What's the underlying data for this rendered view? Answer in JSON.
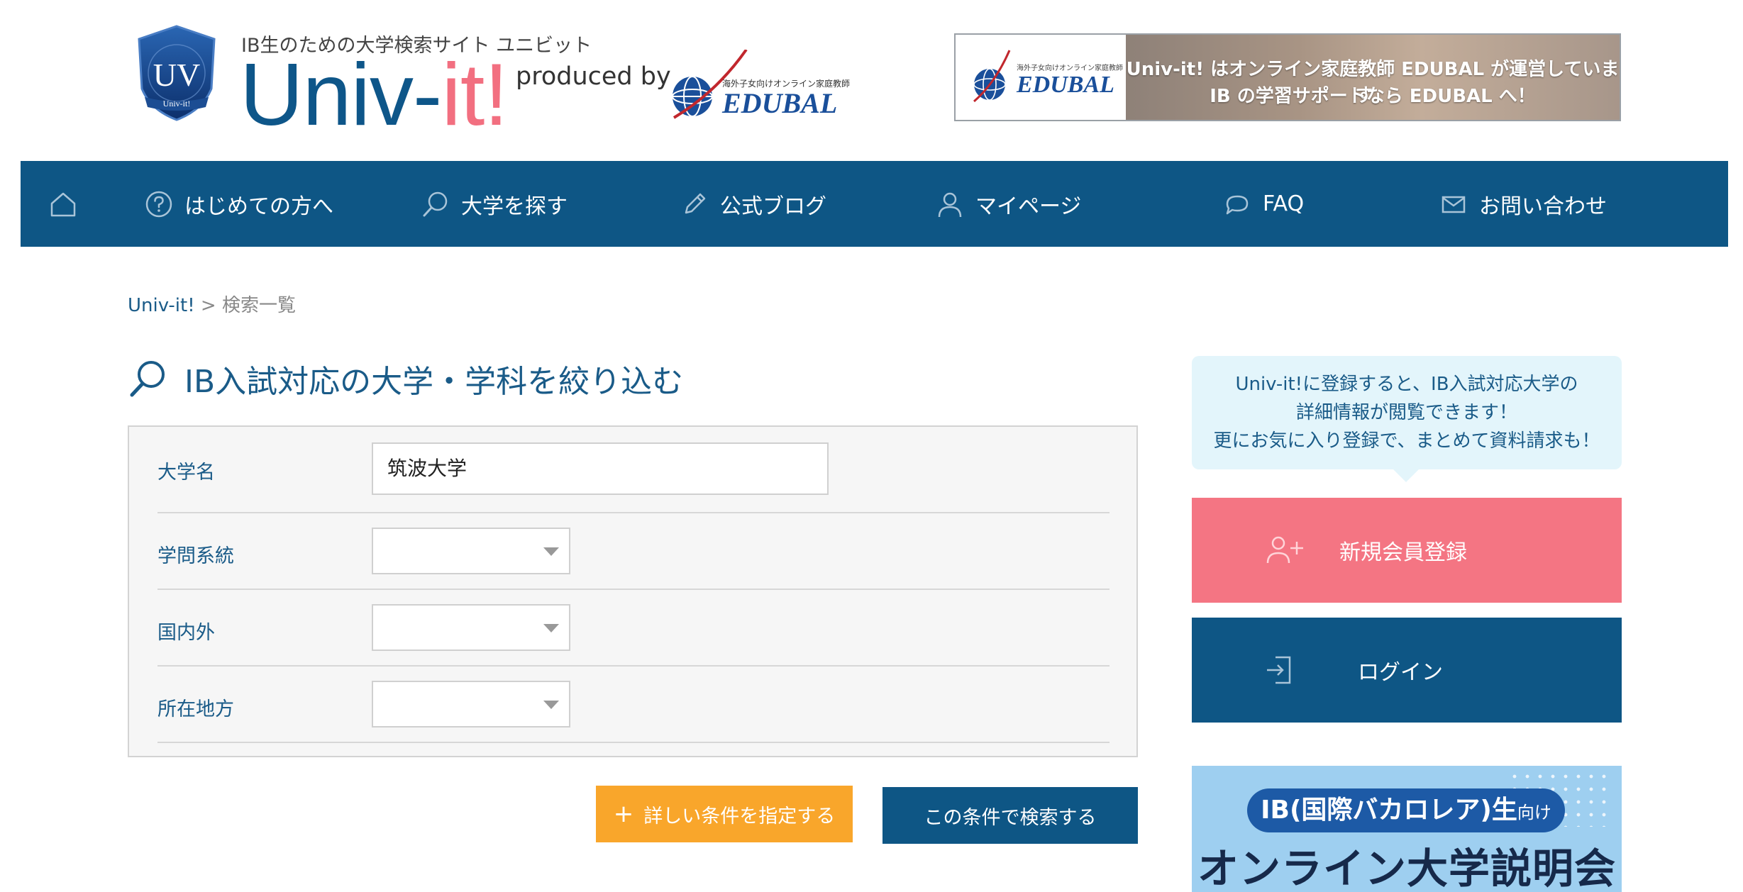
{
  "header": {
    "logo_text": "UV",
    "logo_subtext": "Univ-it!",
    "tagline": "IB生のための大学検索サイト ユニビット",
    "brand_main": "Univ-",
    "brand_accent": "it!",
    "produced_by": "produced by",
    "partner_tagline": "海外子女向けオンライン家庭教師",
    "partner_name": "EDUBAL"
  },
  "banner": {
    "left_tagline": "海外子女向けオンライン家庭教師",
    "left_name": "EDUBAL",
    "line1": "Univ-it! はオンライン家庭教師 EDUBAL が運営しています。",
    "line2": "IB の学習サポートなら EDUBAL へ！"
  },
  "nav": {
    "items": [
      {
        "label": "",
        "icon": "home-icon"
      },
      {
        "label": "はじめての方へ",
        "icon": "question-icon"
      },
      {
        "label": "大学を探す",
        "icon": "search-icon"
      },
      {
        "label": "公式ブログ",
        "icon": "pencil-icon"
      },
      {
        "label": "マイページ",
        "icon": "user-icon"
      },
      {
        "label": "FAQ",
        "icon": "chat-icon"
      },
      {
        "label": "お問い合わせ",
        "icon": "mail-icon"
      }
    ]
  },
  "breadcrumb": {
    "home": "Univ-it!",
    "separator": ">",
    "current": "検索一覧"
  },
  "page_title": "IB入試対応の大学・学科を絞り込む",
  "form": {
    "fields": [
      {
        "label": "大学名",
        "type": "text",
        "value": "筑波大学"
      },
      {
        "label": "学問系統",
        "type": "select",
        "value": ""
      },
      {
        "label": "国内外",
        "type": "select",
        "value": ""
      },
      {
        "label": "所在地方",
        "type": "select",
        "value": ""
      }
    ],
    "detail_button": "詳しい条件を指定する",
    "detail_button_icon": "+",
    "search_button": "この条件で検索する"
  },
  "sidebar": {
    "info_lines": [
      "Univ-it!に登録すると、IB入試対応大学の",
      "詳細情報が閲覧できます！",
      "更にお気に入り登録で、まとめて資料請求も！"
    ],
    "register_button": "新規会員登録",
    "login_button": "ログイン",
    "promo_pill_main": "IB(国際バカロレア)生",
    "promo_pill_small": "向け",
    "promo_big": "オンライン大学説明会"
  },
  "colors": {
    "primary": "#0e5685",
    "accent_pink": "#f47583",
    "accent_orange": "#f9a62b",
    "bubble": "#e3f5fb"
  }
}
